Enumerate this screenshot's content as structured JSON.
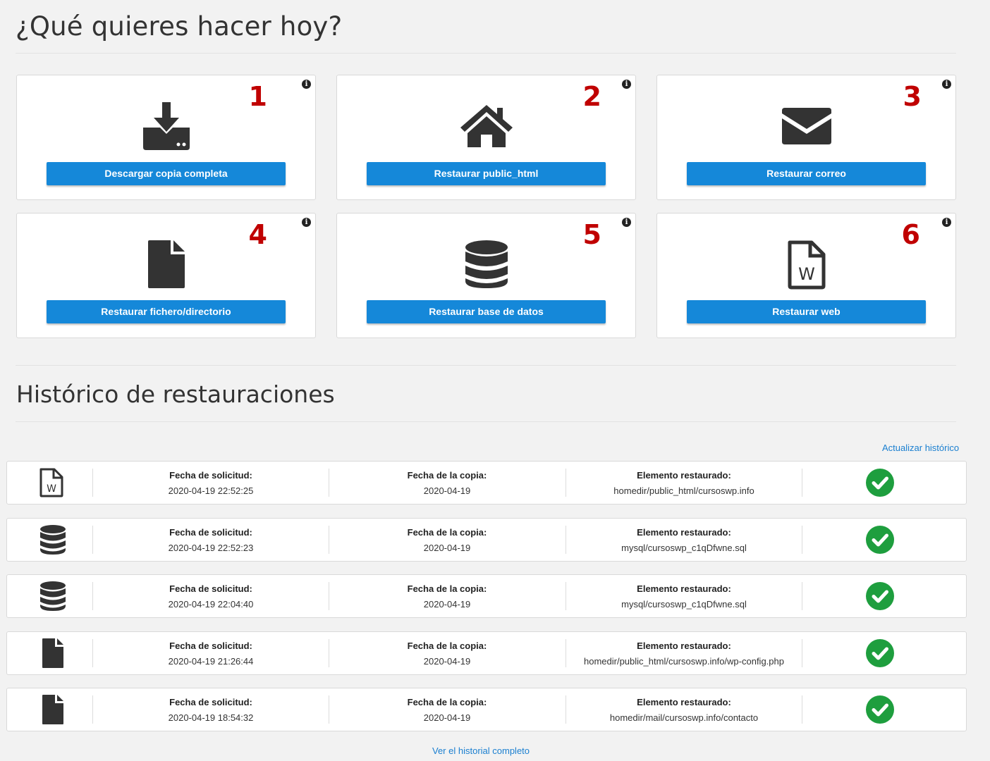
{
  "header": {
    "title": "¿Qué quieres hacer hoy?"
  },
  "colors": {
    "accent": "#1588d9",
    "number": "#c00000",
    "success": "#1e9e3e",
    "icon": "#333333"
  },
  "actions": [
    {
      "number": "1",
      "label": "Descargar copia completa",
      "icon": "download-icon"
    },
    {
      "number": "2",
      "label": "Restaurar public_html",
      "icon": "home-icon"
    },
    {
      "number": "3",
      "label": "Restaurar correo",
      "icon": "envelope-icon"
    },
    {
      "number": "4",
      "label": "Restaurar fichero/directorio",
      "icon": "file-icon"
    },
    {
      "number": "5",
      "label": "Restaurar base de datos",
      "icon": "database-icon"
    },
    {
      "number": "6",
      "label": "Restaurar web",
      "icon": "wordpress-file-icon"
    }
  ],
  "history": {
    "title": "Histórico de restauraciones",
    "refresh_label": "Actualizar histórico",
    "full_history_label": "Ver el historial completo",
    "labels": {
      "requested": "Fecha de solicitud:",
      "backup": "Fecha de la copia:",
      "element": "Elemento restaurado:"
    },
    "rows": [
      {
        "icon": "wordpress-file-icon",
        "requested": "2020-04-19 22:52:25",
        "backup": "2020-04-19",
        "element": "homedir/public_html/cursoswp.info",
        "status": "success"
      },
      {
        "icon": "database-icon",
        "requested": "2020-04-19 22:52:23",
        "backup": "2020-04-19",
        "element": "mysql/cursoswp_c1qDfwne.sql",
        "status": "success"
      },
      {
        "icon": "database-icon",
        "requested": "2020-04-19 22:04:40",
        "backup": "2020-04-19",
        "element": "mysql/cursoswp_c1qDfwne.sql",
        "status": "success"
      },
      {
        "icon": "file-icon",
        "requested": "2020-04-19 21:26:44",
        "backup": "2020-04-19",
        "element": "homedir/public_html/cursoswp.info/wp-config.php",
        "status": "success"
      },
      {
        "icon": "file-icon",
        "requested": "2020-04-19 18:54:32",
        "backup": "2020-04-19",
        "element": "homedir/mail/cursoswp.info/contacto",
        "status": "success"
      }
    ]
  }
}
